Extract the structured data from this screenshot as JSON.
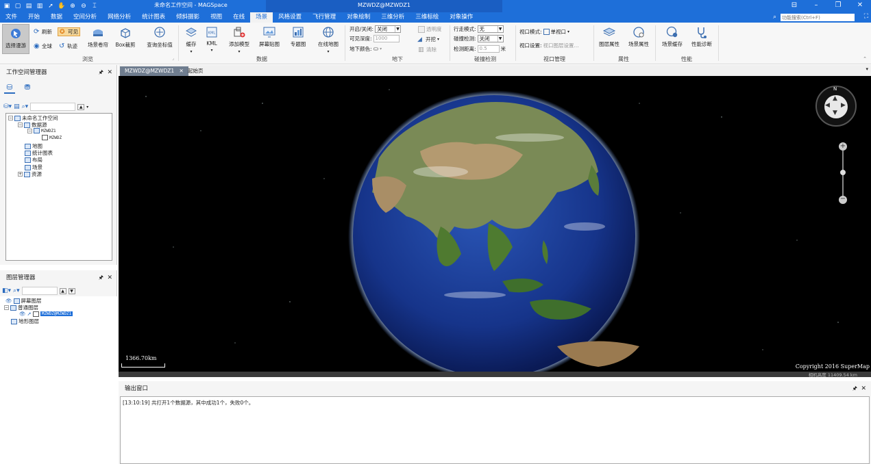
{
  "window": {
    "title": "未命名工作空间 - MAGSpace",
    "center_title": "MZWDZ@MZWDZ1",
    "controls": [
      "⊟",
      "–",
      "❐",
      "✕"
    ]
  },
  "menu": {
    "items": [
      "文件",
      "开始",
      "数据",
      "空间分析",
      "网络分析",
      "统计图表",
      "倾斜摄影",
      "视图",
      "在线",
      "场景",
      "风格设置",
      "飞行管理",
      "对象绘制",
      "三维分析",
      "三维标绘",
      "对象操作"
    ],
    "active_index": 9,
    "search_placeholder": "功能搜索(Ctrl+F)"
  },
  "ribbon": {
    "browse": {
      "group": "浏览",
      "select_roam": "选择漫游",
      "refresh": "刷新",
      "visible": "可见",
      "globe": "全球",
      "track": "轨迹",
      "scene_roll": "场景卷帘",
      "box_clip": "Box裁剪",
      "query_coords": "查询坐标值"
    },
    "data": {
      "group": "数据",
      "cache": "缓存",
      "kml": "KML",
      "add_model": "添加模型",
      "screen_paste": "屏幕贴图",
      "thematic": "专题图",
      "online_map": "在线地图"
    },
    "underground": {
      "group": "地下",
      "onoff_label": "开启/关闭:",
      "onoff_value": "关闭",
      "depth_label": "可见深度:",
      "depth_value": "1000",
      "color_label": "地下颜色:",
      "transparency": "透明度",
      "excavate": "开挖",
      "clear": "清除"
    },
    "collision": {
      "group": "碰撞检测",
      "walk_mode_label": "行走模式:",
      "walk_mode_value": "无",
      "detect_label": "碰撞检测:",
      "detect_value": "关闭",
      "distance_label": "检测距离:",
      "distance_value": "0.5",
      "distance_unit": "米"
    },
    "viewport": {
      "group": "视口管理",
      "mode_label": "视口模式:",
      "mode_value": "单视口",
      "settings_label": "视口设置:",
      "settings_value": "视口图层设置..."
    },
    "properties": {
      "group": "属性",
      "layer_props": "图层属性",
      "scene_props": "场景属性"
    },
    "performance": {
      "group": "性能",
      "scene_cache": "场景缓存",
      "diagnose": "性能诊断"
    }
  },
  "workspace_manager": {
    "title": "工作空间管理器",
    "tree": {
      "root": "未命名工作空间",
      "datasources": "数据源",
      "ds1": "MZWDZ1",
      "ds1_child": "MZWDZ",
      "maps": "地图",
      "charts": "统计图表",
      "layouts": "布局",
      "scenes": "场景",
      "resources": "资源"
    }
  },
  "layer_manager": {
    "title": "图层管理器",
    "tree": {
      "screen": "屏幕图层",
      "normal": "普通图层",
      "layer1": "MZWDZ@MZWDZ1",
      "terrain": "地形图层"
    }
  },
  "doc_tabs": [
    "MZWDZ@MZWDZ1",
    "起始页"
  ],
  "scene": {
    "scale_text": "1366.70km",
    "copyright": "Copyright 2016 SuperMap",
    "camera_height": "相机高度 11409.54 km",
    "compass_n": "N"
  },
  "output": {
    "title": "输出窗口",
    "log": "[13:10:19] 共打开1个数据源，其中成功1个，失败0个。"
  }
}
